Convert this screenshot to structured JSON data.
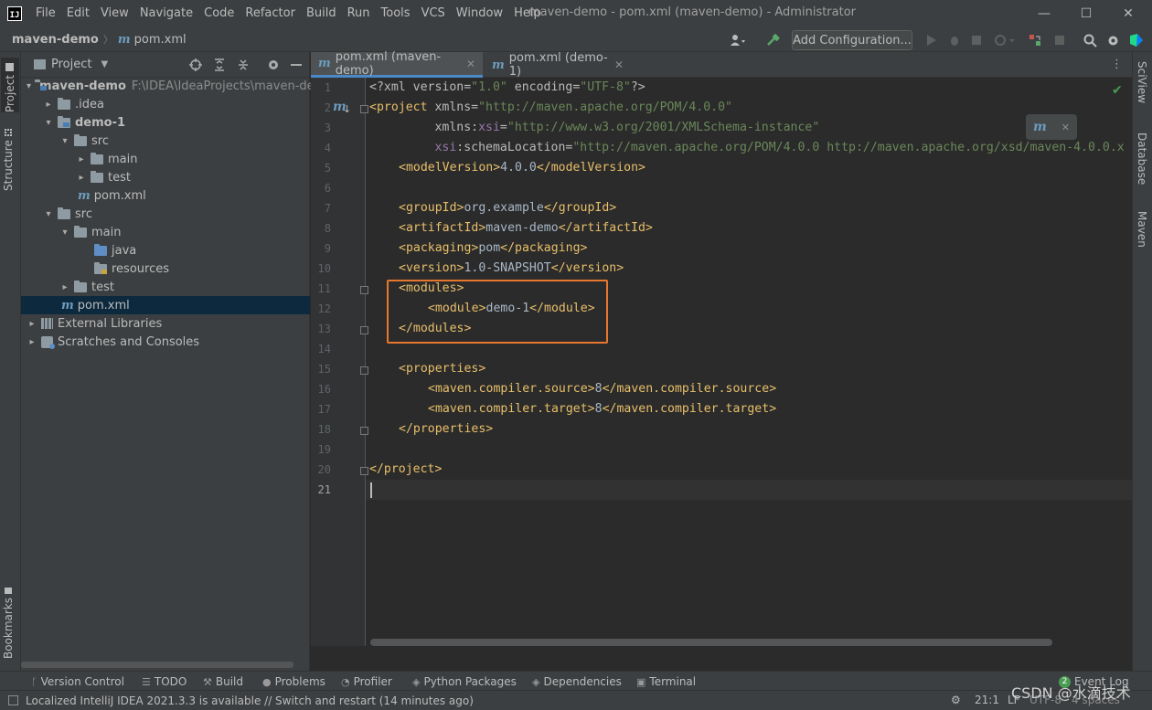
{
  "menubar": {
    "app_logo": "IJ",
    "items": [
      "File",
      "Edit",
      "View",
      "Navigate",
      "Code",
      "Refactor",
      "Build",
      "Run",
      "Tools",
      "VCS",
      "Window",
      "Help"
    ],
    "window_title": "maven-demo - pom.xml (maven-demo) - Administrator",
    "minimize_glyph": "—",
    "maximize_glyph": "☐",
    "close_glyph": "✕"
  },
  "navbar": {
    "project_crumb": "maven-demo",
    "file_crumb": "pom.xml",
    "add_configuration": "Add Configuration..."
  },
  "left_stripe": {
    "project_tab": "Project",
    "structure_tab": "Structure",
    "bookmarks_tab": "Bookmarks"
  },
  "right_stripe": {
    "sciview_tab": "SciView",
    "database_tab": "Database",
    "maven_tab": "Maven"
  },
  "project_panel": {
    "title": "Project",
    "tree": [
      {
        "label": "maven-demo",
        "path": "F:\\IDEA\\IdeaProjects\\maven-der"
      },
      {
        "label": ".idea"
      },
      {
        "label": "demo-1"
      },
      {
        "label": "src"
      },
      {
        "label": "main"
      },
      {
        "label": "test"
      },
      {
        "label": "pom.xml"
      },
      {
        "label": "src"
      },
      {
        "label": "main"
      },
      {
        "label": "java"
      },
      {
        "label": "resources"
      },
      {
        "label": "test"
      },
      {
        "label": "pom.xml"
      },
      {
        "label": "External Libraries"
      },
      {
        "label": "Scratches and Consoles"
      }
    ]
  },
  "editor_tabs": [
    {
      "label": "pom.xml (maven-demo)",
      "active": true
    },
    {
      "label": "pom.xml (demo-1)",
      "active": false
    }
  ],
  "editor": {
    "current_line": 21,
    "lines": [
      "1",
      "2",
      "3",
      "4",
      "5",
      "6",
      "7",
      "8",
      "9",
      "10",
      "11",
      "12",
      "13",
      "14",
      "15",
      "16",
      "17",
      "18",
      "19",
      "20",
      "21"
    ],
    "code": {
      "l1_a": "<?xml version=",
      "l1_b": "\"1.0\"",
      "l1_c": " encoding=",
      "l1_d": "\"UTF-8\"",
      "l1_e": "?>",
      "l2_a": "<project ",
      "l2_b": "xmlns=",
      "l2_c": "\"http://maven.apache.org/POM/4.0.0\"",
      "l3_a": "         xmlns:",
      "l3_b": "xsi",
      "l3_c": "=",
      "l3_d": "\"http://www.w3.org/2001/XMLSchema-instance\"",
      "l4_a": "         ",
      "l4_b": "xsi",
      "l4_c": ":schemaLocation=",
      "l4_d": "\"http://maven.apache.org/POM/4.0.0 http://maven.apache.org/xsd/maven-4.0.0.x",
      "l5_open": "<modelVersion>",
      "l5_val": "4.0.0",
      "l5_close": "</modelVersion>",
      "l7_open": "<groupId>",
      "l7_val": "org.example",
      "l7_close": "</groupId>",
      "l8_open": "<artifactId>",
      "l8_val": "maven-demo",
      "l8_close": "</artifactId>",
      "l9_open": "<packaging>",
      "l9_val": "pom",
      "l9_close": "</packaging>",
      "l10_open": "<version>",
      "l10_val": "1.0-SNAPSHOT",
      "l10_close": "</version>",
      "l11": "<modules>",
      "l12_open": "<module>",
      "l12_val": "demo-1",
      "l12_close": "</module>",
      "l13": "</modules>",
      "l15": "<properties>",
      "l16_open": "<maven.compiler.source>",
      "l16_val": "8",
      "l16_close": "</maven.compiler.source>",
      "l17_open": "<maven.compiler.target>",
      "l17_val": "8",
      "l17_close": "</maven.compiler.target>",
      "l18": "</properties>",
      "l20": "</project>"
    }
  },
  "tool_bar": {
    "items": [
      "Version Control",
      "TODO",
      "Build",
      "Problems",
      "Profiler",
      "Python Packages",
      "Dependencies",
      "Terminal"
    ],
    "event_log_count": "2",
    "event_log": "Event Log"
  },
  "status_bar": {
    "message": "Localized IntelliJ IDEA 2021.3.3 is available // Switch and restart (14 minutes ago)",
    "position": "21:1",
    "line_sep": "LF",
    "encoding": "UTF-8",
    "indent": "4 spaces"
  },
  "watermark": "CSDN @水滴技术",
  "colors": {
    "accent": "#4a88c7",
    "highlight_box": "#e8772e",
    "tag": "#e8bf6a",
    "string": "#6a8759",
    "ok": "#499c54"
  }
}
